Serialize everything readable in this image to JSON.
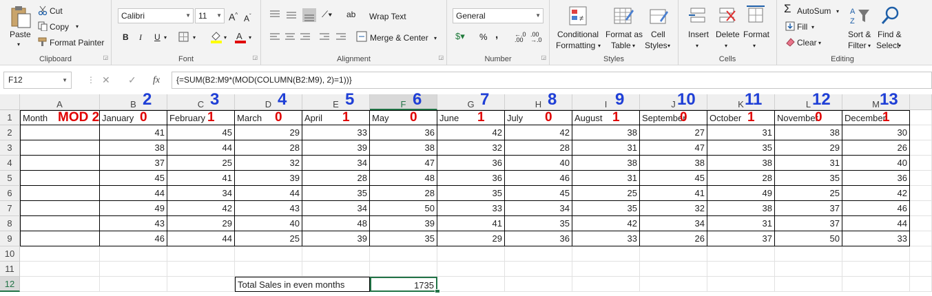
{
  "ribbon": {
    "clipboard": {
      "paste": "Paste",
      "cut": "Cut",
      "copy": "Copy",
      "format_painter": "Format Painter",
      "label": "Clipboard"
    },
    "font": {
      "name": "Calibri",
      "size": "11",
      "bold": "B",
      "italic": "I",
      "underline": "U",
      "label": "Font"
    },
    "alignment": {
      "wrap_text": "Wrap Text",
      "merge_center": "Merge & Center",
      "label": "Alignment"
    },
    "number": {
      "format": "General",
      "percent": "%",
      "comma": ",",
      "label": "Number"
    },
    "styles": {
      "conditional": "Conditional",
      "conditional2": "Formatting",
      "format_as": "Format as",
      "format_as2": "Table",
      "cell": "Cell",
      "cell2": "Styles",
      "label": "Styles"
    },
    "cells": {
      "insert": "Insert",
      "delete": "Delete",
      "format": "Format",
      "label": "Cells"
    },
    "editing": {
      "autosum": "AutoSum",
      "fill": "Fill",
      "clear": "Clear",
      "sort": "Sort &",
      "sort2": "Filter",
      "find": "Find &",
      "find2": "Select",
      "label": "Editing"
    }
  },
  "formula_bar": {
    "name_box": "F12",
    "cancel": "✕",
    "enter": "✓",
    "fx": "fx",
    "formula": "{=SUM(B2:M9*(MOD(COLUMN(B2:M9), 2)=1))}"
  },
  "sheet": {
    "columns": [
      "A",
      "B",
      "C",
      "D",
      "E",
      "F",
      "G",
      "H",
      "I",
      "J",
      "K",
      "L",
      "M"
    ],
    "column_numbers": [
      "2",
      "3",
      "4",
      "5",
      "6",
      "7",
      "8",
      "9",
      "10",
      "11",
      "12",
      "13"
    ],
    "headers": [
      "Month",
      "January",
      "February",
      "March",
      "April",
      "May",
      "June",
      "July",
      "August",
      "September",
      "October",
      "November",
      "December"
    ],
    "mod_label": "MOD 2",
    "mod_values": [
      "0",
      "1",
      "0",
      "1",
      "0",
      "1",
      "0",
      "1",
      "0",
      "1",
      "0",
      "1"
    ],
    "rows": [
      [
        "41",
        "45",
        "29",
        "33",
        "36",
        "42",
        "42",
        "38",
        "27",
        "31",
        "38",
        "30"
      ],
      [
        "38",
        "44",
        "28",
        "39",
        "38",
        "32",
        "28",
        "31",
        "47",
        "35",
        "29",
        "26"
      ],
      [
        "37",
        "25",
        "32",
        "34",
        "47",
        "36",
        "40",
        "38",
        "38",
        "38",
        "31",
        "40"
      ],
      [
        "45",
        "41",
        "39",
        "28",
        "48",
        "36",
        "46",
        "31",
        "45",
        "28",
        "35",
        "36"
      ],
      [
        "44",
        "34",
        "44",
        "35",
        "28",
        "35",
        "45",
        "25",
        "41",
        "49",
        "25",
        "42"
      ],
      [
        "49",
        "42",
        "43",
        "34",
        "50",
        "33",
        "34",
        "35",
        "32",
        "38",
        "37",
        "46"
      ],
      [
        "43",
        "29",
        "40",
        "48",
        "39",
        "41",
        "35",
        "42",
        "34",
        "31",
        "37",
        "44"
      ],
      [
        "46",
        "44",
        "25",
        "39",
        "35",
        "29",
        "36",
        "33",
        "26",
        "37",
        "50",
        "33"
      ]
    ],
    "row_numbers": [
      "1",
      "2",
      "3",
      "4",
      "5",
      "6",
      "7",
      "8",
      "9",
      "10",
      "11",
      "12"
    ],
    "total_label": "Total Sales in even months",
    "total_value": "1735"
  }
}
